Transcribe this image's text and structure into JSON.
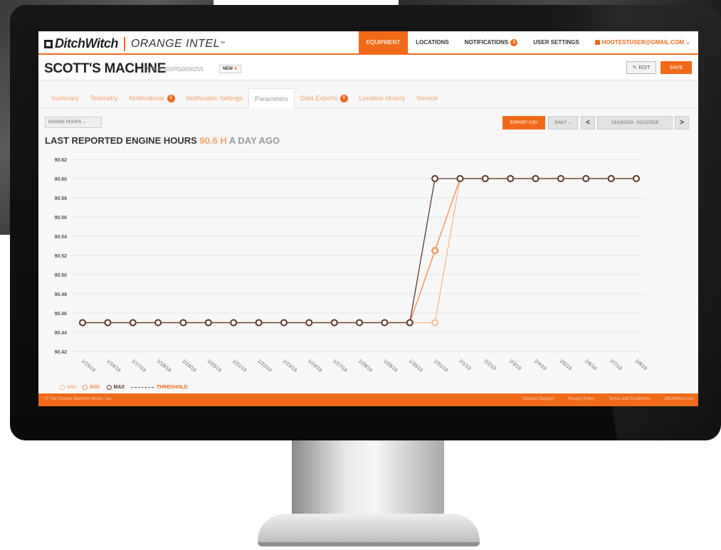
{
  "brand": {
    "logo": "DitchWitch",
    "product": "ORANGE INTEL",
    "trademark": "™"
  },
  "nav": {
    "items": [
      {
        "label": "EQUIPMENT",
        "active": true
      },
      {
        "label": "LOCATIONS",
        "active": false
      },
      {
        "label": "NOTIFICATIONS",
        "badge": "3",
        "active": false
      },
      {
        "label": "USER SETTINGS",
        "active": false
      },
      {
        "label": "HOOTESTUSER@GMAIL.COM ⌄",
        "active": false
      }
    ]
  },
  "machine": {
    "name": "SCOTT'S MACHINE",
    "serial": "CMWJT30XPG0000255",
    "tag": "NEW",
    "tag_close": "✕",
    "edit_label": "EDIT",
    "save_label": "SAVE"
  },
  "tabs": [
    {
      "label": "Summary"
    },
    {
      "label": "Telemetry"
    },
    {
      "label": "Notifications",
      "badge": "8"
    },
    {
      "label": "Notification Settings"
    },
    {
      "label": "Parameters",
      "active": true
    },
    {
      "label": "Data Exports",
      "badge": "8"
    },
    {
      "label": "Location History"
    },
    {
      "label": "Service"
    }
  ],
  "controls": {
    "parameter": "ENGINE HOURS ⌄",
    "export": "EXPORT CSV",
    "period": "DAILY ⌄",
    "prev": "<",
    "range": "01/14/2019 - 02/12/2019",
    "next": ">"
  },
  "headline": {
    "prefix": "LAST REPORTED ENGINE HOURS ",
    "value": "90.6 H",
    "suffix": " A DAY AGO"
  },
  "legend": {
    "min": "MIN",
    "avg": "AVG",
    "max": "MAX",
    "threshold": "THRESHOLD",
    "colors": {
      "min": "#f8b98d",
      "avg": "#f08a4a",
      "max": "#5b3a2e",
      "threshold": "#f06a1a"
    }
  },
  "footer": {
    "copyright": "© The Charles Machine Works, Inc.",
    "links": [
      "Contact Support",
      "Privacy Policy",
      "Terms and Conditions",
      "DitchWitch.com"
    ]
  },
  "chart_data": {
    "type": "line",
    "x": [
      "1/15/19",
      "1/16/19",
      "1/17/19",
      "1/18/19",
      "1/19/19",
      "1/20/19",
      "1/21/19",
      "1/22/19",
      "1/23/19",
      "1/24/19",
      "1/27/19",
      "1/28/19",
      "1/29/19",
      "1/30/19",
      "1/31/19",
      "2/1/19",
      "2/2/19",
      "2/3/19",
      "2/4/19",
      "2/5/19",
      "2/6/19",
      "2/7/19",
      "2/8/19"
    ],
    "yticks": [
      "90.62",
      "90.60",
      "90.58",
      "90.56",
      "90.54",
      "90.52",
      "90.50",
      "90.48",
      "90.46",
      "90.44",
      "90.42"
    ],
    "ylim": [
      90.42,
      90.62
    ],
    "series": [
      {
        "name": "MIN",
        "values": [
          90.45,
          90.45,
          90.45,
          90.45,
          90.45,
          90.45,
          90.45,
          90.45,
          90.45,
          90.45,
          90.45,
          90.45,
          90.45,
          90.45,
          90.45,
          90.6,
          90.6,
          90.6,
          90.6,
          90.6,
          90.6,
          90.6,
          90.6
        ]
      },
      {
        "name": "AVG",
        "values": [
          90.45,
          90.45,
          90.45,
          90.45,
          90.45,
          90.45,
          90.45,
          90.45,
          90.45,
          90.45,
          90.45,
          90.45,
          90.45,
          90.45,
          90.525,
          90.6,
          90.6,
          90.6,
          90.6,
          90.6,
          90.6,
          90.6,
          90.6
        ]
      },
      {
        "name": "MAX",
        "values": [
          90.45,
          90.45,
          90.45,
          90.45,
          90.45,
          90.45,
          90.45,
          90.45,
          90.45,
          90.45,
          90.45,
          90.45,
          90.45,
          90.45,
          90.6,
          90.6,
          90.6,
          90.6,
          90.6,
          90.6,
          90.6,
          90.6,
          90.6
        ]
      }
    ],
    "grid": true,
    "legend_position": "bottom-left"
  }
}
